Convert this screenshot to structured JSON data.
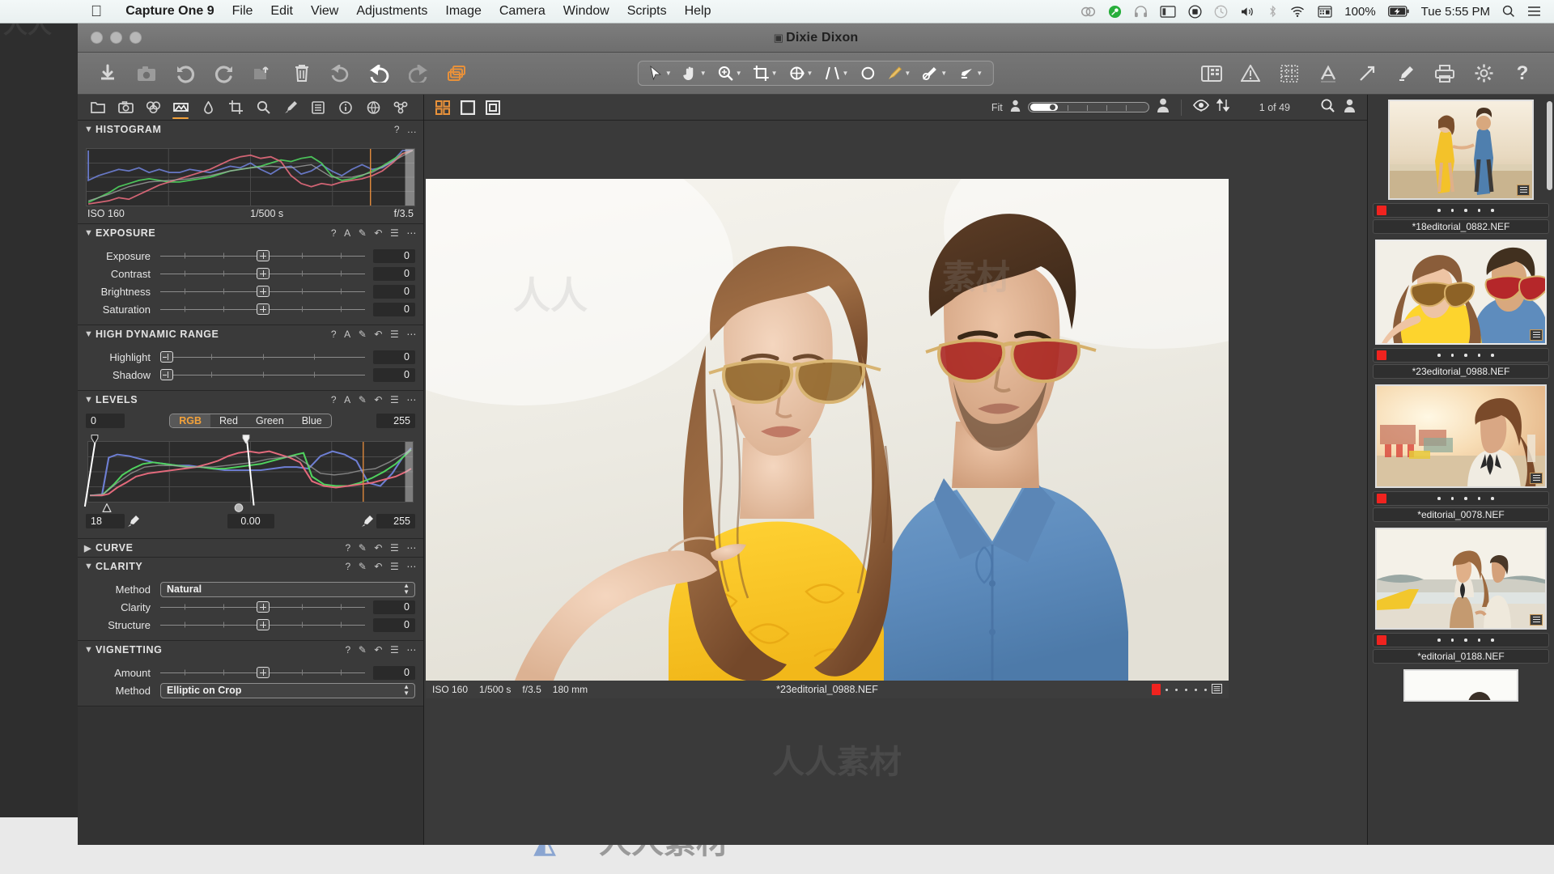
{
  "menubar": {
    "apple_icon": "apple-logo",
    "items": [
      "Capture One 9",
      "File",
      "Edit",
      "View",
      "Adjustments",
      "Image",
      "Camera",
      "Window",
      "Scripts",
      "Help"
    ],
    "status_icons": [
      "creative-cloud-icon",
      "dropbox-green-icon",
      "headphones-icon",
      "display-icon",
      "record-icon",
      "timemachine-icon",
      "volume-icon",
      "bluetooth-icon",
      "wifi-icon",
      "keyboard-input-icon"
    ],
    "battery_percent": "100%",
    "battery_icon": "battery-charging-icon",
    "time": "Tue 5:55 PM",
    "spotlight_icon": "search-icon",
    "notification_icon": "list-icon"
  },
  "window": {
    "title": "Dixie Dixon",
    "title_badge_icon": "document-icon"
  },
  "toolbar": {
    "left_icons": [
      "import-images-icon",
      "capture-tethered-icon",
      "undo-arrow-icon",
      "redo-arrow-icon",
      "export-icon",
      "trash-icon",
      "reset-icon",
      "undo-icon",
      "redo-icon",
      "copy-apply-icon"
    ],
    "center_tools": [
      {
        "name": "pointer-tool",
        "has_caret": true
      },
      {
        "name": "pan-tool",
        "has_caret": true
      },
      {
        "name": "zoom-tool",
        "has_caret": true
      },
      {
        "name": "crop-tool",
        "has_caret": true
      },
      {
        "name": "rotate-tool",
        "has_caret": true
      },
      {
        "name": "keystone-tool",
        "has_caret": true
      },
      {
        "name": "spot-removal-tool",
        "has_caret": false
      },
      {
        "name": "draw-mask-tool",
        "has_caret": true
      },
      {
        "name": "heal-clone-tool",
        "has_caret": true
      },
      {
        "name": "erase-mask-tool",
        "has_caret": true
      }
    ],
    "right_icons": [
      "layout-icon",
      "warning-icon",
      "grid-icon",
      "annotation-icon",
      "straighten-icon",
      "color-picker-icon",
      "print-icon",
      "preferences-icon",
      "help-icon"
    ]
  },
  "left_panel": {
    "tabs": [
      "library-tab",
      "capture-tab",
      "lens-tab",
      "color-tab",
      "exposure-tab",
      "details-tab",
      "crop-tab",
      "adjustments-tab",
      "metadata-tab",
      "output-tab",
      "info-tab",
      "batch-tab"
    ],
    "active_tab_index": 3,
    "sections": [
      {
        "id": "histogram",
        "title": "HISTOGRAM",
        "expanded": true,
        "actions": [
          "?",
          "..."
        ],
        "exif": {
          "iso": "ISO 160",
          "shutter": "1/500 s",
          "aperture": "f/3.5"
        }
      },
      {
        "id": "exposure",
        "title": "EXPOSURE",
        "expanded": true,
        "actions": [
          "?",
          "A",
          "picker",
          "reset",
          "menu",
          "..."
        ],
        "rows": [
          {
            "label": "Exposure",
            "value": "0",
            "knob": 50,
            "style": "center"
          },
          {
            "label": "Contrast",
            "value": "0",
            "knob": 50,
            "style": "center"
          },
          {
            "label": "Brightness",
            "value": "0",
            "knob": 50,
            "style": "center"
          },
          {
            "label": "Saturation",
            "value": "0",
            "knob": 50,
            "style": "center"
          }
        ]
      },
      {
        "id": "hdr",
        "title": "HIGH DYNAMIC RANGE",
        "expanded": true,
        "actions": [
          "?",
          "A",
          "picker",
          "reset",
          "menu",
          "..."
        ],
        "rows": [
          {
            "label": "Highlight",
            "value": "0",
            "knob": 0,
            "style": "left"
          },
          {
            "label": "Shadow",
            "value": "0",
            "knob": 0,
            "style": "left"
          }
        ]
      },
      {
        "id": "levels",
        "title": "LEVELS",
        "expanded": true,
        "actions": [
          "?",
          "A",
          "picker",
          "reset",
          "menu",
          "..."
        ],
        "input_black": "0",
        "input_white": "255",
        "channels": [
          "RGB",
          "Red",
          "Green",
          "Blue"
        ],
        "active_channel": "RGB",
        "output_black": "18",
        "output_mid": "0.00",
        "output_white": "255"
      },
      {
        "id": "curve",
        "title": "CURVE",
        "expanded": false,
        "actions": [
          "?",
          "picker",
          "reset",
          "menu",
          "..."
        ]
      },
      {
        "id": "clarity",
        "title": "CLARITY",
        "expanded": true,
        "actions": [
          "?",
          "picker",
          "reset",
          "menu",
          "..."
        ],
        "method_label": "Method",
        "method_value": "Natural",
        "rows": [
          {
            "label": "Clarity",
            "value": "0",
            "knob": 50,
            "style": "center"
          },
          {
            "label": "Structure",
            "value": "0",
            "knob": 50,
            "style": "center"
          }
        ]
      },
      {
        "id": "vignetting",
        "title": "VIGNETTING",
        "expanded": true,
        "actions": [
          "?",
          "picker",
          "reset",
          "menu",
          "..."
        ],
        "rows": [
          {
            "label": "Amount",
            "value": "0",
            "knob": 50,
            "style": "center"
          }
        ],
        "method_label": "Method",
        "method_value": "Elliptic on Crop"
      }
    ]
  },
  "viewer": {
    "view_icons": [
      "grid-view-icon",
      "single-view-icon",
      "compare-view-icon"
    ],
    "zoom_label": "Fit",
    "zoom_small_icon": "person-small-icon",
    "zoom_large_icon": "person-large-icon",
    "proof_icon": "eye-icon",
    "sort_icon": "sort-updown-icon",
    "counter": "1 of 49",
    "search_icon": "search-filter-icon",
    "user_icon": "person-icon",
    "status": {
      "iso": "ISO 160",
      "shutter": "1/500 s",
      "aperture": "f/3.5",
      "focal": "180 mm",
      "filename": "*23editorial_0988.NEF",
      "color_tag": "#f0231f",
      "stars": 5
    }
  },
  "browser": {
    "thumbnails": [
      {
        "filename": "*18editorial_0882.NEF",
        "scene": "beach-couple-yellow-dress",
        "selected": false,
        "color_tag": "#f0231f",
        "stars": 5
      },
      {
        "filename": "*23editorial_0988.NEF",
        "scene": "sunglasses-couple",
        "selected": true,
        "color_tag": "#f0231f",
        "stars": 5
      },
      {
        "filename": "*editorial_0078.NEF",
        "scene": "sunset-woman-street",
        "selected": false,
        "color_tag": "#f0231f",
        "stars": 5
      },
      {
        "filename": "*editorial_0188.NEF",
        "scene": "beach-couple-white",
        "selected": false,
        "color_tag": "#f0231f",
        "stars": 5
      }
    ]
  },
  "watermarks": {
    "text": "人人素材",
    "short": "人人"
  },
  "colors": {
    "accent_orange": "#f2a13a",
    "panel_bg": "#3a3a3a",
    "toolbar_bg": "#6e6e6e",
    "tag_red": "#f0231f"
  }
}
